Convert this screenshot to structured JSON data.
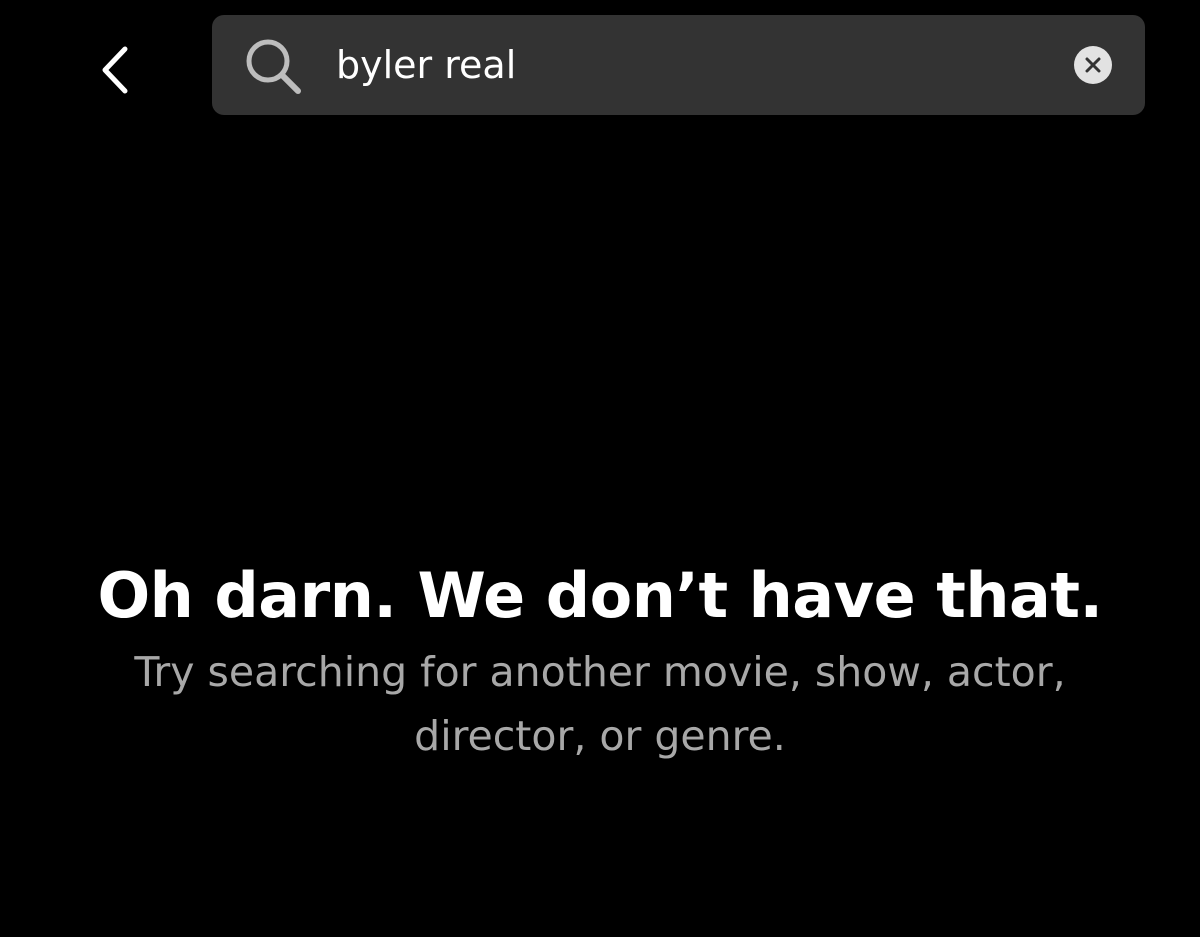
{
  "header": {
    "back_icon": "chevron-left-icon"
  },
  "search": {
    "icon": "search-icon",
    "value": "byler real",
    "clear_icon": "close-circle-icon"
  },
  "empty_state": {
    "title": "Oh darn. We don’t have that.",
    "subtitle": "Try searching for another movie, show, actor, director, or genre."
  },
  "colors": {
    "background": "#000000",
    "search_bar": "#333333",
    "title_text": "#ffffff",
    "subtitle_text": "#a8a8a8",
    "clear_button": "#e2e2e2"
  }
}
